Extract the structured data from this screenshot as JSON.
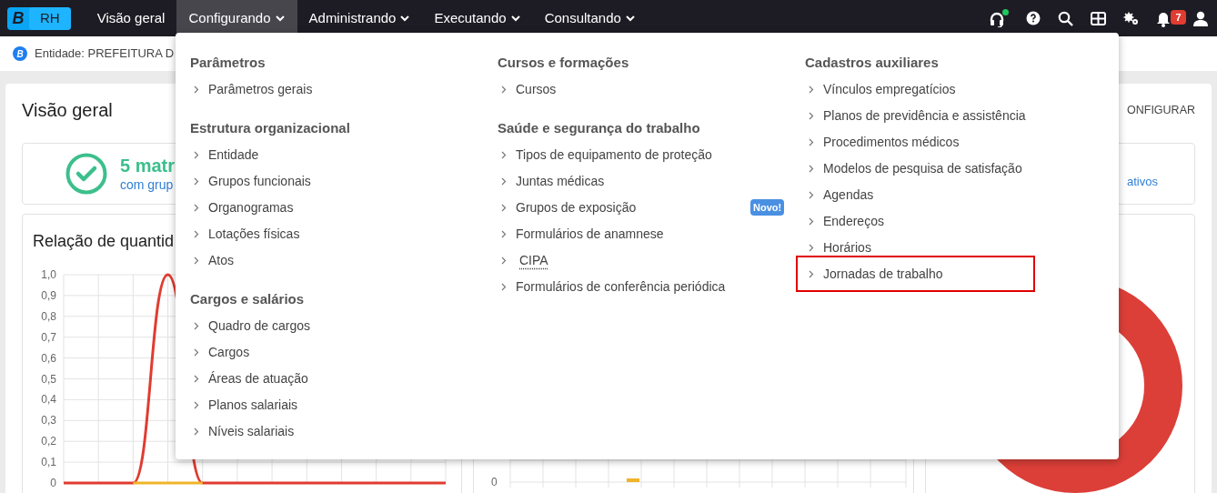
{
  "navbar": {
    "logo_letter": "B",
    "app_name": "RH",
    "menus": [
      {
        "label": "Visão geral",
        "has_caret": false,
        "selected": false
      },
      {
        "label": "Configurando",
        "has_caret": true,
        "selected": true
      },
      {
        "label": "Administrando",
        "has_caret": true,
        "selected": false
      },
      {
        "label": "Executando",
        "has_caret": true,
        "selected": false
      },
      {
        "label": "Consultando",
        "has_caret": true,
        "selected": false
      }
    ],
    "support_online": true,
    "notification_count": "7"
  },
  "entity_bar": {
    "logo_letter": "B",
    "text": "Entidade: PREFEITURA D"
  },
  "overview": {
    "title": "Visão geral",
    "configure_link": "ONFIGURAR",
    "summary": {
      "headline": "5 matr",
      "subtitle": "com grup",
      "right_text": "ativos"
    },
    "left_chart": {
      "title": "Relação de quantid",
      "chart_data": {
        "type": "line",
        "grid": true,
        "ylim": [
          0,
          1
        ],
        "yticks": [
          {
            "value": 1,
            "label": "1,0"
          },
          {
            "value": 0.9,
            "label": "0,9"
          },
          {
            "value": 0.8,
            "label": "0,8"
          },
          {
            "value": 0.7,
            "label": "0,7"
          },
          {
            "value": 0.6,
            "label": "0,6"
          },
          {
            "value": 0.5,
            "label": "0,5"
          },
          {
            "value": 0.4,
            "label": "0,4"
          },
          {
            "value": 0.3,
            "label": "0,3"
          },
          {
            "value": 0.2,
            "label": "0,2"
          },
          {
            "value": 0.1,
            "label": "0,1"
          },
          {
            "value": 0,
            "label": "0"
          }
        ],
        "series": [
          {
            "color": "#e03c31",
            "values": [
              0,
              0,
              0,
              1,
              0,
              0,
              0,
              0,
              0,
              0,
              0,
              0
            ]
          },
          {
            "color": "#f0b429",
            "values": [
              null,
              null,
              0,
              0,
              0,
              null,
              null,
              null,
              null,
              null,
              null,
              null
            ]
          }
        ]
      }
    },
    "middle_chart": {
      "y_tick": "0"
    }
  },
  "dropdown": {
    "columns": [
      {
        "sections": [
          {
            "title": "Parâmetros",
            "items": [
              {
                "label": "Parâmetros gerais",
                "highlighted": false
              }
            ]
          },
          {
            "title": "Estrutura organizacional",
            "items": [
              {
                "label": "Entidade",
                "highlighted": false
              },
              {
                "label": "Grupos funcionais",
                "highlighted": false
              },
              {
                "label": "Organogramas",
                "highlighted": false
              },
              {
                "label": "Lotações físicas",
                "highlighted": false
              },
              {
                "label": "Atos",
                "highlighted": false
              }
            ]
          },
          {
            "title": "Cargos e salários",
            "items": [
              {
                "label": "Quadro de cargos",
                "highlighted": false
              },
              {
                "label": "Cargos",
                "highlighted": false
              },
              {
                "label": "Áreas de atuação",
                "highlighted": false
              },
              {
                "label": "Planos salariais",
                "highlighted": false
              },
              {
                "label": "Níveis salariais",
                "highlighted": false
              }
            ]
          }
        ]
      },
      {
        "sections": [
          {
            "title": "Cursos e formações",
            "items": [
              {
                "label": "Cursos",
                "highlighted": false
              }
            ]
          },
          {
            "title": "Saúde e segurança do trabalho",
            "items": [
              {
                "label": "Tipos de equipamento de proteção",
                "highlighted": false
              },
              {
                "label": "Juntas médicas",
                "highlighted": false
              },
              {
                "label": "Grupos de exposição",
                "badge": "Novo!",
                "highlighted": false
              },
              {
                "label": "Formulários de anamnese",
                "highlighted": false
              },
              {
                "label": "CIPA",
                "underlined": true,
                "highlighted": false
              },
              {
                "label": "Formulários de conferência periódica",
                "highlighted": false
              }
            ]
          }
        ]
      },
      {
        "sections": [
          {
            "title": "Cadastros auxiliares",
            "items": [
              {
                "label": "Vínculos empregatícios",
                "highlighted": false
              },
              {
                "label": "Planos de previdência e assistência",
                "highlighted": false
              },
              {
                "label": "Procedimentos médicos",
                "highlighted": false
              },
              {
                "label": "Modelos de pesquisa de satisfação",
                "highlighted": false
              },
              {
                "label": "Agendas",
                "highlighted": false
              },
              {
                "label": "Endereços",
                "highlighted": false
              },
              {
                "label": "Horários",
                "highlighted": false
              },
              {
                "label": "Jornadas de trabalho",
                "highlighted": true
              }
            ]
          }
        ]
      }
    ]
  }
}
